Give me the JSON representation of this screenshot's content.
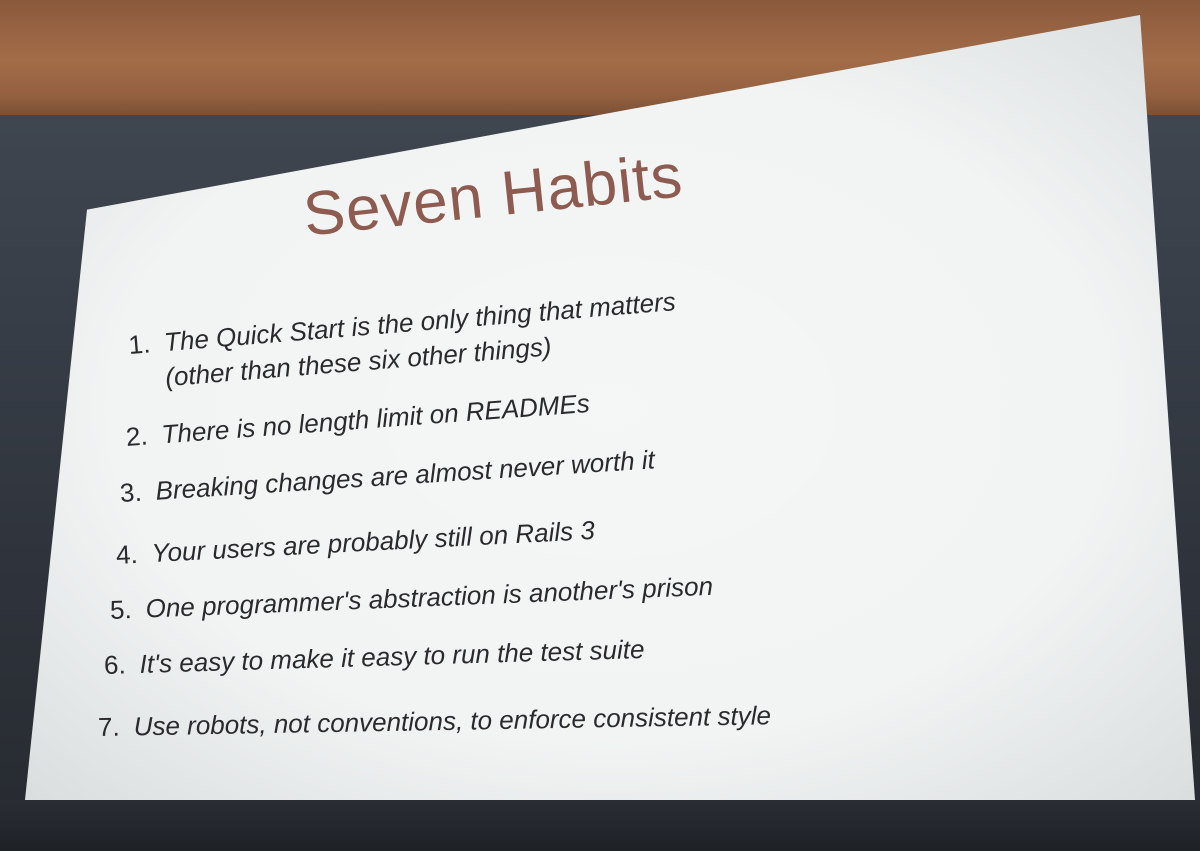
{
  "slide": {
    "title": "Seven Habits",
    "habits": [
      {
        "num": "1.",
        "text": "The Quick Start is the only thing that matters",
        "sub": "(other than these six other things)"
      },
      {
        "num": "2.",
        "text": "There is no length limit on READMEs"
      },
      {
        "num": "3.",
        "text": "Breaking changes are almost never worth it"
      },
      {
        "num": "4.",
        "text": "Your users are probably still on Rails 3"
      },
      {
        "num": "5.",
        "text": "One programmer's abstraction is another's prison"
      },
      {
        "num": "6.",
        "text": "It's easy to make it easy to run the test suite"
      },
      {
        "num": "7.",
        "text": "Use robots, not conventions, to enforce consistent style"
      }
    ]
  },
  "colors": {
    "slide_background": "#f1f4f3",
    "title_color": "#8e5b50",
    "text_color": "#2a2a2e",
    "backdrop": "#2f343c",
    "wall": "#a36c48"
  }
}
